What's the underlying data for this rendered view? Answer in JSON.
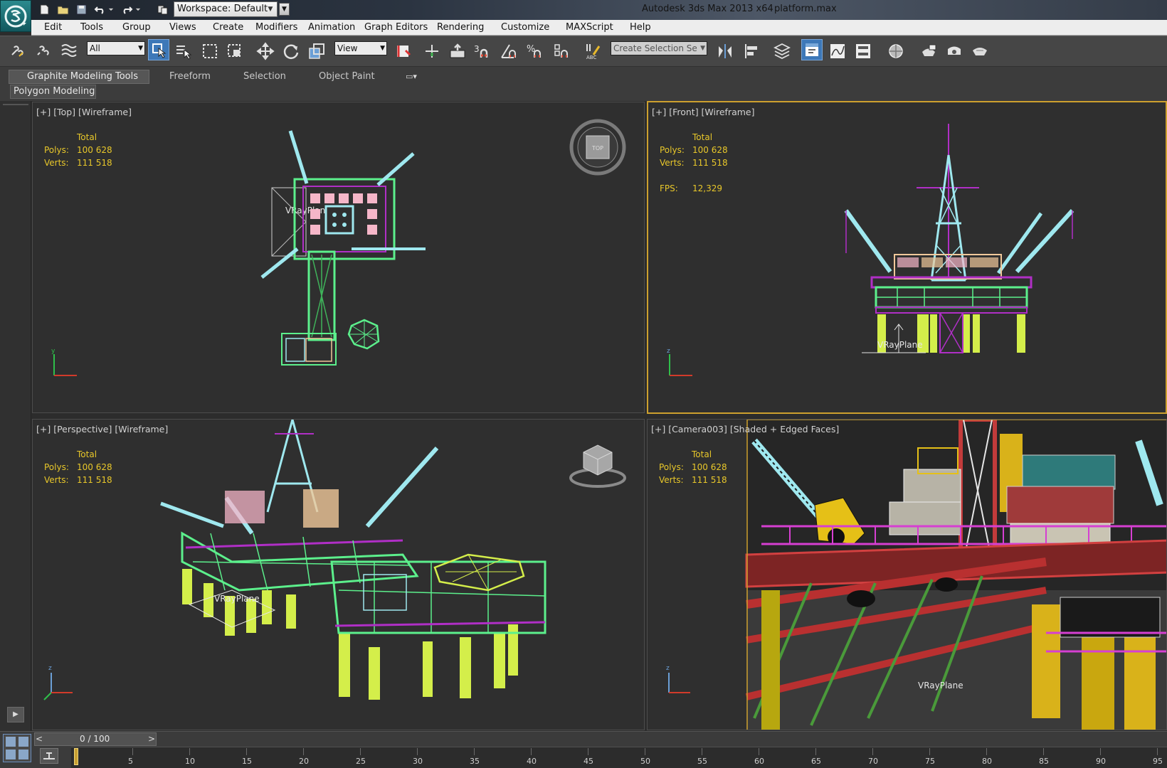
{
  "window": {
    "app_title": "Autodesk 3ds Max  2013 x64",
    "file_name": "platform.max"
  },
  "workspace": {
    "label": "Workspace: Default"
  },
  "menu": [
    "Edit",
    "Tools",
    "Group",
    "Views",
    "Create",
    "Modifiers",
    "Animation",
    "Graph Editors",
    "Rendering",
    "Customize",
    "MAXScript",
    "Help"
  ],
  "toolbar": {
    "selection_filter": "All",
    "reference_coord": "View",
    "named_selection_placeholder": "Create Selection Se",
    "snap_label": "3",
    "icons": [
      "select-and-link-icon",
      "unlink-icon",
      "bind-to-space-warp-icon",
      "select-object-icon",
      "select-by-name-icon",
      "rectangular-selection-icon",
      "window-crossing-icon",
      "select-and-move-icon",
      "select-and-rotate-icon",
      "select-and-scale-icon",
      "use-pivot-icon",
      "select-manipulate-icon",
      "keyboard-shortcut-icon",
      "snaps-toggle-icon",
      "angle-snap-icon",
      "percent-snap-icon",
      "spinner-snap-icon",
      "edit-named-selection-icon",
      "mirror-icon",
      "align-icon",
      "layer-manager-icon",
      "graphite-toggle-icon",
      "curve-editor-icon",
      "schematic-view-icon",
      "material-editor-icon",
      "render-setup-icon",
      "rendered-frame-icon",
      "render-icon"
    ]
  },
  "ribbon": {
    "tabs": [
      "Graphite Modeling Tools",
      "Freeform",
      "Selection",
      "Object Paint"
    ],
    "active_tab": "Graphite Modeling Tools",
    "panel": "Polygon Modeling"
  },
  "viewports": {
    "top": {
      "label": "[+] [Top] [Wireframe]",
      "stats": {
        "header": "Total",
        "polys_label": "Polys:",
        "polys": "100 628",
        "verts_label": "Verts:",
        "verts": "111 518"
      },
      "gizmo_label": "TOP",
      "object_label": "VRayPlane"
    },
    "front": {
      "label": "[+] [Front] [Wireframe]",
      "stats": {
        "header": "Total",
        "polys_label": "Polys:",
        "polys": "100 628",
        "verts_label": "Verts:",
        "verts": "111 518",
        "fps_label": "FPS:",
        "fps": "12,329"
      },
      "object_label": "VRayPlane",
      "active": true
    },
    "perspective": {
      "label": "[+] [Perspective] [Wireframe]",
      "stats": {
        "header": "Total",
        "polys_label": "Polys:",
        "polys": "100 628",
        "verts_label": "Verts:",
        "verts": "111 518"
      },
      "object_label": "VRayPlane"
    },
    "camera": {
      "label": "[+] [Camera003] [Shaded + Edged Faces]",
      "stats": {
        "header": "Total",
        "polys_label": "Polys:",
        "polys": "100 628",
        "verts_label": "Verts:",
        "verts": "111 518"
      },
      "object_label": "VRayPlane"
    }
  },
  "timeslider": {
    "frame": "0 / 100",
    "prev": "<",
    "next": ">"
  },
  "timeline": {
    "ticks": [
      "5",
      "10",
      "15",
      "20",
      "25",
      "30",
      "35",
      "40",
      "45",
      "50",
      "55",
      "60",
      "65",
      "70",
      "75",
      "80",
      "85",
      "90",
      "95"
    ]
  },
  "colors": {
    "accent_active_viewport": "#cda02e",
    "stats_text": "#e8c72a",
    "wire_green": "#5cf08c",
    "wire_cyan": "#9fe8ef",
    "wire_magenta": "#b02fc6",
    "wire_yellow": "#d4ee4a",
    "wire_pink": "#f5b6c8",
    "wire_peach": "#f0c89a",
    "selected_button": "#3d78b8"
  }
}
